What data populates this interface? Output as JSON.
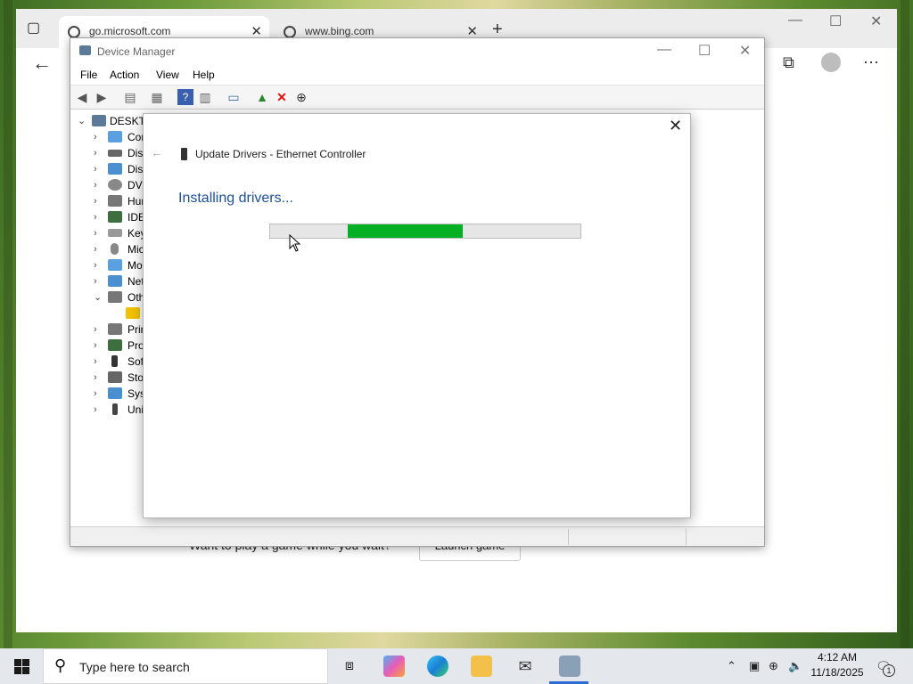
{
  "browser": {
    "tabs": [
      {
        "title": "go.microsoft.com",
        "active": true
      },
      {
        "title": "www.bing.com",
        "active": false
      }
    ],
    "page": {
      "prompt": "Want to play a game while you wait?",
      "button": "Launch game"
    }
  },
  "device_manager": {
    "title": "Device Manager",
    "menu": [
      "File",
      "Action",
      "View",
      "Help"
    ],
    "toolbar_icons": [
      "back-arrow-icon",
      "forward-arrow-icon",
      "show-hide-tree-icon",
      "properties-icon",
      "help-icon",
      "view-icon",
      "scan-hardware-icon",
      "update-driver-icon",
      "uninstall-icon",
      "disable-icon"
    ],
    "tree": {
      "root": "DESKTO",
      "items": [
        {
          "label": "Cor",
          "expanded": false
        },
        {
          "label": "Disl",
          "expanded": false
        },
        {
          "label": "Disp",
          "expanded": false
        },
        {
          "label": "DVD",
          "expanded": false
        },
        {
          "label": "Hur",
          "expanded": false
        },
        {
          "label": "IDE",
          "expanded": false
        },
        {
          "label": "Key",
          "expanded": false
        },
        {
          "label": "Mic",
          "expanded": false
        },
        {
          "label": "Mo",
          "expanded": false
        },
        {
          "label": "Net",
          "expanded": false
        },
        {
          "label": "Oth",
          "expanded": true
        },
        {
          "label": "",
          "expanded": false,
          "child": true,
          "warning": true
        },
        {
          "label": "Prir",
          "expanded": false
        },
        {
          "label": "Pro",
          "expanded": false
        },
        {
          "label": "Sof",
          "expanded": false
        },
        {
          "label": "Sto",
          "expanded": false
        },
        {
          "label": "Syst",
          "expanded": false
        },
        {
          "label": "Uni",
          "expanded": false
        }
      ]
    }
  },
  "dialog": {
    "title": "Update Drivers - Ethernet Controller",
    "heading": "Installing drivers...",
    "progress": {
      "segment_start": 0.25,
      "segment_end": 0.62,
      "color": "#06b025"
    }
  },
  "taskbar": {
    "search_placeholder": "Type here to search",
    "apps": [
      "task-view-icon",
      "copilot-icon",
      "edge-icon",
      "file-explorer-icon",
      "mail-icon",
      "device-manager-icon"
    ],
    "clock": {
      "time": "4:12 AM",
      "date": "11/18/2025"
    },
    "notification_count": "1"
  }
}
